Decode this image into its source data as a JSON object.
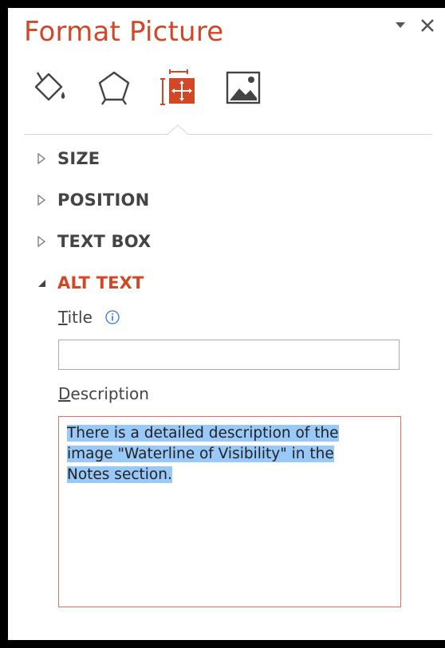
{
  "pane": {
    "title": "Format Picture",
    "controls": {
      "options": "dropdown",
      "close": "close"
    }
  },
  "tabs": [
    {
      "icon": "fill-line-icon",
      "active": false
    },
    {
      "icon": "effects-icon",
      "active": false
    },
    {
      "icon": "size-properties-icon",
      "active": true
    },
    {
      "icon": "picture-icon",
      "active": false
    }
  ],
  "sections": {
    "size": {
      "label": "SIZE",
      "expanded": false
    },
    "position": {
      "label": "POSITION",
      "expanded": false
    },
    "text_box": {
      "label": "TEXT BOX",
      "expanded": false
    },
    "alt_text": {
      "label": "ALT TEXT",
      "expanded": true
    }
  },
  "alt_text": {
    "title_label_first": "T",
    "title_label_rest": "itle",
    "title_value": "",
    "description_label_first": "D",
    "description_label_rest": "escription",
    "description_lines": [
      "There is a detailed description of the",
      "image \"Waterline of Visibility\" in the",
      "Notes section."
    ]
  },
  "colors": {
    "accent": "#D24726",
    "selection": "#99C9F8",
    "text": "#444444"
  }
}
